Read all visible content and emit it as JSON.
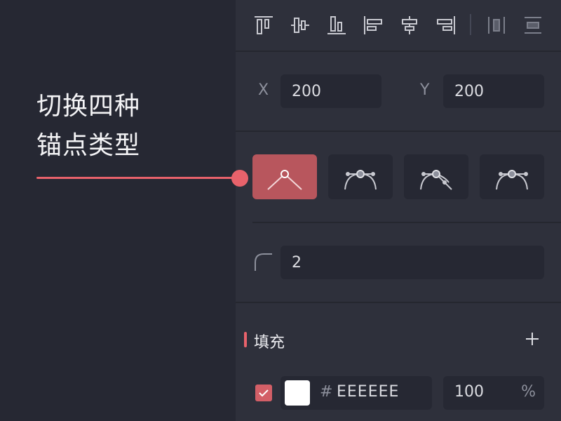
{
  "callout": {
    "line1": "切换四种",
    "line2": "锚点类型",
    "accent_color": "#e8626b"
  },
  "toolbar": {
    "tools": [
      {
        "icon": "align-top-icon"
      },
      {
        "icon": "align-vertical-center-icon"
      },
      {
        "icon": "align-bottom-icon"
      },
      {
        "icon": "align-left-icon"
      },
      {
        "icon": "align-horizontal-center-icon"
      },
      {
        "icon": "align-right-icon"
      },
      {
        "icon": "distribute-horizontal-icon"
      },
      {
        "icon": "distribute-vertical-icon"
      }
    ]
  },
  "position": {
    "x_label": "X",
    "x_value": "200",
    "y_label": "Y",
    "y_value": "200"
  },
  "anchor_types": {
    "options": [
      {
        "icon": "corner-anchor-icon",
        "selected": true
      },
      {
        "icon": "mirrored-anchor-icon",
        "selected": false
      },
      {
        "icon": "disconnected-anchor-icon",
        "selected": false
      },
      {
        "icon": "asymmetric-anchor-icon",
        "selected": false
      }
    ],
    "active_color": "#b8565d"
  },
  "corner_radius": {
    "icon": "corner-radius-icon",
    "value": "2"
  },
  "fill": {
    "title": "填充",
    "add_icon": "plus-icon",
    "enabled": true,
    "color_hex": "#ffffff",
    "hash": "#",
    "hex_value": "EEEEEE",
    "opacity": "100",
    "opacity_unit": "%"
  }
}
